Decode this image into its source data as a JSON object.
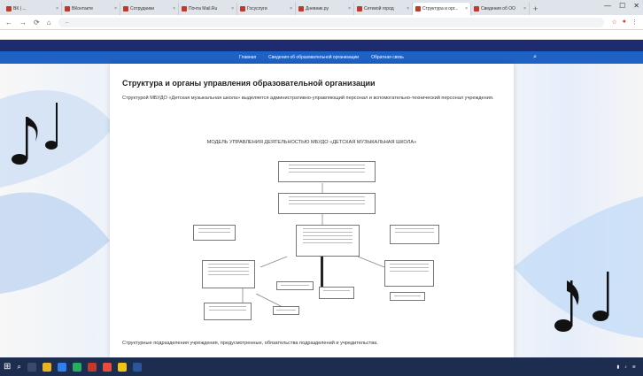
{
  "browser": {
    "tabs": [
      {
        "label": "ВК | ...",
        "active": false
      },
      {
        "label": "ВКонтакте",
        "active": false
      },
      {
        "label": "Сотрудники",
        "active": false
      },
      {
        "label": "Почта Mail.Ru",
        "active": false
      },
      {
        "label": "Госуслуги",
        "active": false
      },
      {
        "label": "Дневник.ру",
        "active": false
      },
      {
        "label": "Сетевой город",
        "active": false
      },
      {
        "label": "Структура и орг...",
        "active": true
      },
      {
        "label": "Сведения об ОО",
        "active": false
      }
    ],
    "url": "..."
  },
  "site": {
    "nav": {
      "items": [
        "Главная",
        "Сведения об образовательной организации",
        "Обратная связь"
      ]
    }
  },
  "page": {
    "title": "Структура и органы управления образовательной организации",
    "intro": "Структурой МБУДО «Детская музыкальная школа» выделяется административно-управляющий персонал и вспомогательно-технический персонал учреждения.",
    "diagram_title": "МОДЕЛЬ УПРАВЛЕНИЯ ДЕЯТЕЛЬНОСТЬЮ МБУДО «ДЕТСКАЯ МУЗЫКАЛЬНАЯ ШКОЛА»",
    "bottom_text": "Структурные подразделения учреждения, предусмотренные, обязательства подразделений и учредительства."
  },
  "colors": {
    "site_top": "#1e2b6e",
    "site_nav": "#1e62c6",
    "taskbar": "#1c2d4f"
  }
}
